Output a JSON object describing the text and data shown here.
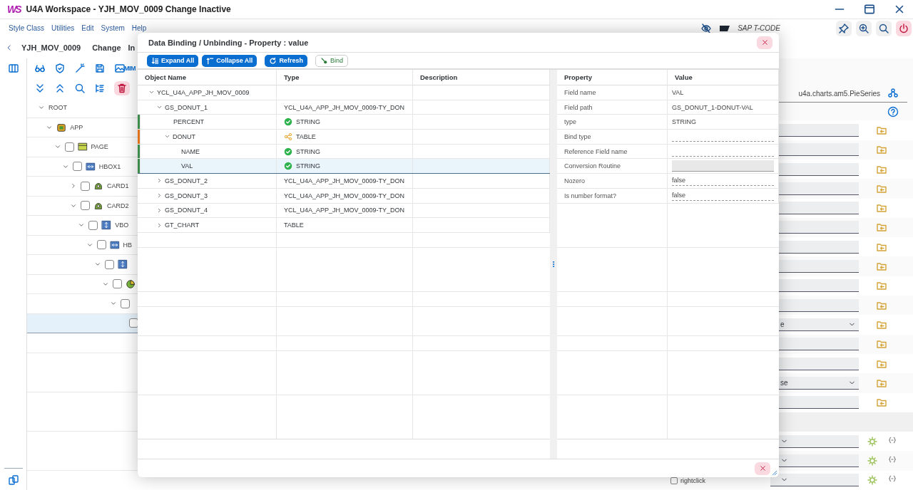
{
  "window": {
    "logo": "WS",
    "title": "U4A Workspace - YJH_MOV_0009 Change Inactive"
  },
  "menu": [
    "Style Class",
    "Utilities",
    "Edit",
    "System",
    "Help"
  ],
  "tcode": {
    "label": "SAP T-CODE"
  },
  "header": {
    "app": "YJH_MOV_0009",
    "mode": "Change",
    "status": "In"
  },
  "toolbar": {
    "mime_label": "MIM"
  },
  "tree": [
    {
      "label": "ROOT",
      "expanded": true,
      "selected": false,
      "children": [
        {
          "label": "APP",
          "kind": "app",
          "expanded": true,
          "selected": false,
          "children": [
            {
              "label": "PAGE",
              "kind": "page",
              "checked": false,
              "expanded": true,
              "selected": false,
              "children": [
                {
                  "label": "HBOX1",
                  "kind": "hbox",
                  "checked": false,
                  "expanded": true,
                  "selected": false,
                  "children": [
                    {
                      "label": "CARD1",
                      "kind": "card",
                      "checked": false,
                      "expanded": false,
                      "selected": false
                    },
                    {
                      "label": "CARD2",
                      "kind": "card",
                      "checked": false,
                      "expanded": true,
                      "selected": false,
                      "children": [
                        {
                          "label": "VBO",
                          "kind": "vbox",
                          "checked": false,
                          "expanded": true,
                          "selected": false,
                          "children": [
                            {
                              "label": "HB",
                              "kind": "hbox",
                              "checked": false,
                              "expanded": true,
                              "selected": false,
                              "children": [
                                {
                                  "kind": "vbox",
                                  "checked": false,
                                  "expanded": true,
                                  "selected": false,
                                  "children": [
                                    {
                                      "kind": "chart",
                                      "checked": false,
                                      "expanded": true,
                                      "selected": false,
                                      "children": [
                                        {
                                          "checked": false,
                                          "expanded": true,
                                          "selected": false,
                                          "children": [
                                            {
                                              "checked": false,
                                              "selected": true
                                            }
                                          ]
                                        }
                                      ]
                                    }
                                  ]
                                }
                              ]
                            }
                          ]
                        }
                      ]
                    }
                  ]
                }
              ]
            }
          ]
        }
      ]
    }
  ],
  "inspector": {
    "class_name": "u4a.charts.am5.PieSeries",
    "rows": [
      {
        "kind": "input"
      },
      {
        "kind": "input"
      },
      {
        "kind": "input"
      },
      {
        "kind": "input"
      },
      {
        "kind": "input"
      },
      {
        "kind": "input"
      },
      {
        "kind": "input"
      },
      {
        "kind": "input"
      },
      {
        "kind": "input"
      },
      {
        "kind": "input"
      },
      {
        "kind": "select",
        "value": "e"
      },
      {
        "kind": "input"
      },
      {
        "kind": "input"
      },
      {
        "kind": "select",
        "value": "se"
      },
      {
        "kind": "input"
      },
      {
        "kind": "section"
      },
      {
        "kind": "binding"
      },
      {
        "kind": "binding"
      },
      {
        "kind": "binding"
      }
    ]
  },
  "option": {
    "label": "rightclick",
    "checked": false
  },
  "dialog": {
    "title": "Data Binding / Unbinding - Property : value",
    "buttons": [
      {
        "label": "Expand All",
        "kind": "expand"
      },
      {
        "label": "Collapse All",
        "kind": "collapse"
      },
      {
        "label": "Refresh",
        "kind": "refresh"
      },
      {
        "label": "Bind",
        "kind": "bind"
      }
    ],
    "columns": [
      "Object Name",
      "Type",
      "Description"
    ],
    "tree": [
      {
        "name": "YCL_U4A_APP_JH_MOV_0009",
        "expanded": true,
        "selected": false,
        "children": [
          {
            "name": "GS_DONUT_1",
            "type": "YCL_U4A_APP_JH_MOV_0009-TY_DON",
            "expanded": true,
            "selected": false,
            "children": [
              {
                "name": "PERCENT",
                "type": "STRING",
                "kind": "field",
                "color": "#3c8a4c",
                "selected": false
              },
              {
                "name": "DONUT",
                "type": "TABLE",
                "kind": "table",
                "color": "#e0721e",
                "expanded": true,
                "selected": false,
                "children": [
                  {
                    "name": "NAME",
                    "type": "STRING",
                    "kind": "field",
                    "color": "#3c8a4c",
                    "selected": false
                  },
                  {
                    "name": "VAL",
                    "type": "STRING",
                    "kind": "field",
                    "color": "#3c8a4c",
                    "selected": true
                  }
                ]
              }
            ]
          },
          {
            "name": "GS_DONUT_2",
            "type": "YCL_U4A_APP_JH_MOV_0009-TY_DON",
            "expanded": false,
            "selected": false
          },
          {
            "name": "GS_DONUT_3",
            "type": "YCL_U4A_APP_JH_MOV_0009-TY_DON",
            "expanded": false,
            "selected": false
          },
          {
            "name": "GS_DONUT_4",
            "type": "YCL_U4A_APP_JH_MOV_0009-TY_DON",
            "expanded": false,
            "selected": false
          },
          {
            "name": "GT_CHART",
            "type": "TABLE",
            "expanded": false,
            "selected": false
          }
        ]
      }
    ],
    "property_columns": [
      "Property",
      "Value"
    ],
    "properties": [
      {
        "label": "Field name",
        "kind": "text",
        "value": "VAL"
      },
      {
        "label": "Field path",
        "kind": "text",
        "value": "GS_DONUT_1-DONUT-VAL"
      },
      {
        "label": "type",
        "kind": "text",
        "value": "STRING"
      },
      {
        "label": "Bind type",
        "kind": "input"
      },
      {
        "label": "Reference Field name",
        "kind": "input"
      },
      {
        "label": "Conversion Routine",
        "kind": "disabled"
      },
      {
        "label": "Nozero",
        "kind": "input",
        "value": "false"
      },
      {
        "label": "Is number format?",
        "kind": "input",
        "value": "false"
      }
    ]
  }
}
